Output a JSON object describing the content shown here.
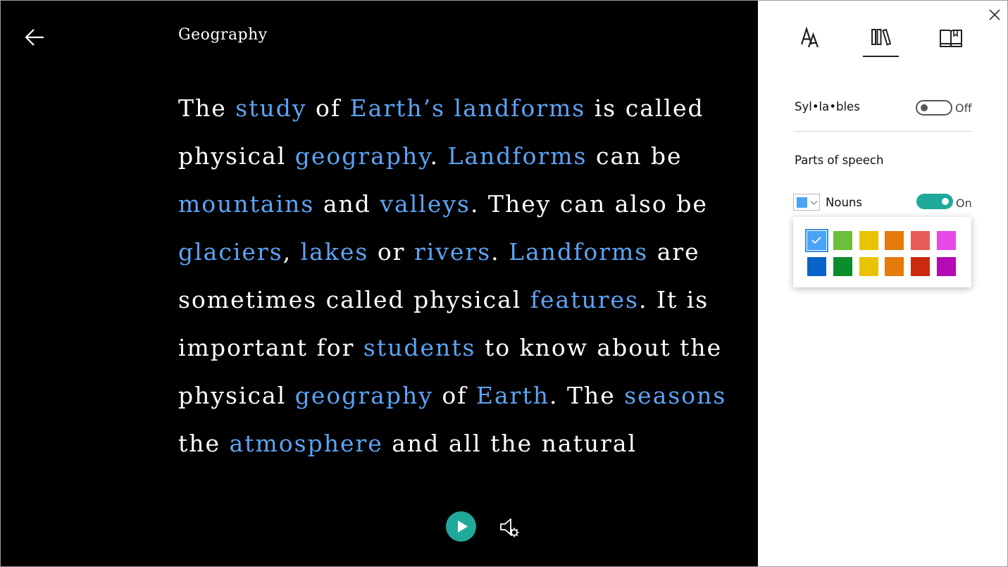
{
  "reader": {
    "title": "Geography",
    "back_icon": "arrow-left-icon",
    "lines": [
      [
        {
          "t": "The ",
          "n": false
        },
        {
          "t": "study",
          "n": true
        },
        {
          "t": " of ",
          "n": false
        },
        {
          "t": "Earth’s landforms",
          "n": true
        },
        {
          "t": " is called",
          "n": false
        }
      ],
      [
        {
          "t": "physical ",
          "n": false
        },
        {
          "t": "geography",
          "n": true
        },
        {
          "t": ". ",
          "n": false
        },
        {
          "t": "Landforms",
          "n": true
        },
        {
          "t": " can be",
          "n": false
        }
      ],
      [
        {
          "t": "mountains",
          "n": true
        },
        {
          "t": " and ",
          "n": false
        },
        {
          "t": "valleys",
          "n": true
        },
        {
          "t": ". They can also be",
          "n": false
        }
      ],
      [
        {
          "t": "glaciers",
          "n": true
        },
        {
          "t": ", ",
          "n": false
        },
        {
          "t": "lakes",
          "n": true
        },
        {
          "t": " or ",
          "n": false
        },
        {
          "t": "rivers",
          "n": true
        },
        {
          "t": ". ",
          "n": false
        },
        {
          "t": "Landforms",
          "n": true
        },
        {
          "t": " are",
          "n": false
        }
      ],
      [
        {
          "t": "sometimes called physical ",
          "n": false
        },
        {
          "t": "features",
          "n": true
        },
        {
          "t": ". It is",
          "n": false
        }
      ],
      [
        {
          "t": "important for ",
          "n": false
        },
        {
          "t": "students",
          "n": true
        },
        {
          "t": " to know about the",
          "n": false
        }
      ],
      [
        {
          "t": "physical ",
          "n": false
        },
        {
          "t": "geography",
          "n": true
        },
        {
          "t": " of ",
          "n": false
        },
        {
          "t": "Earth",
          "n": true
        },
        {
          "t": ". The ",
          "n": false
        },
        {
          "t": "seasons",
          "n": true
        }
      ],
      [
        {
          "t": "the ",
          "n": false
        },
        {
          "t": "atmosphere",
          "n": true
        },
        {
          "t": " and all the natural",
          "n": false
        }
      ]
    ],
    "play_icon": "play-icon",
    "voice_settings_icon": "voice-settings-icon"
  },
  "panel": {
    "close_icon": "close-icon",
    "tabs": [
      {
        "name": "text-preferences",
        "icon": "text-size-icon",
        "selected": false
      },
      {
        "name": "grammar-options",
        "icon": "books-icon",
        "selected": true
      },
      {
        "name": "reading-preferences",
        "icon": "book-open-icon",
        "selected": false
      }
    ],
    "syllables": {
      "label": "Syl•la•bles",
      "state": "Off"
    },
    "parts_of_speech": {
      "heading": "Parts of speech",
      "nouns": {
        "label": "Nouns",
        "state": "On",
        "color": "#4aa3f6"
      }
    },
    "palette": [
      "#4aa3f6",
      "#6cbf3b",
      "#e9c300",
      "#e57b0a",
      "#e85c57",
      "#e64ae6",
      "#0a63c9",
      "#0a8d2a",
      "#e9c300",
      "#e57b0a",
      "#cc2a0e",
      "#b40bb4"
    ],
    "selected_color_index": 0,
    "colors": {
      "accent": "#1fa99a",
      "noun_text": "#5ba4f5"
    }
  }
}
